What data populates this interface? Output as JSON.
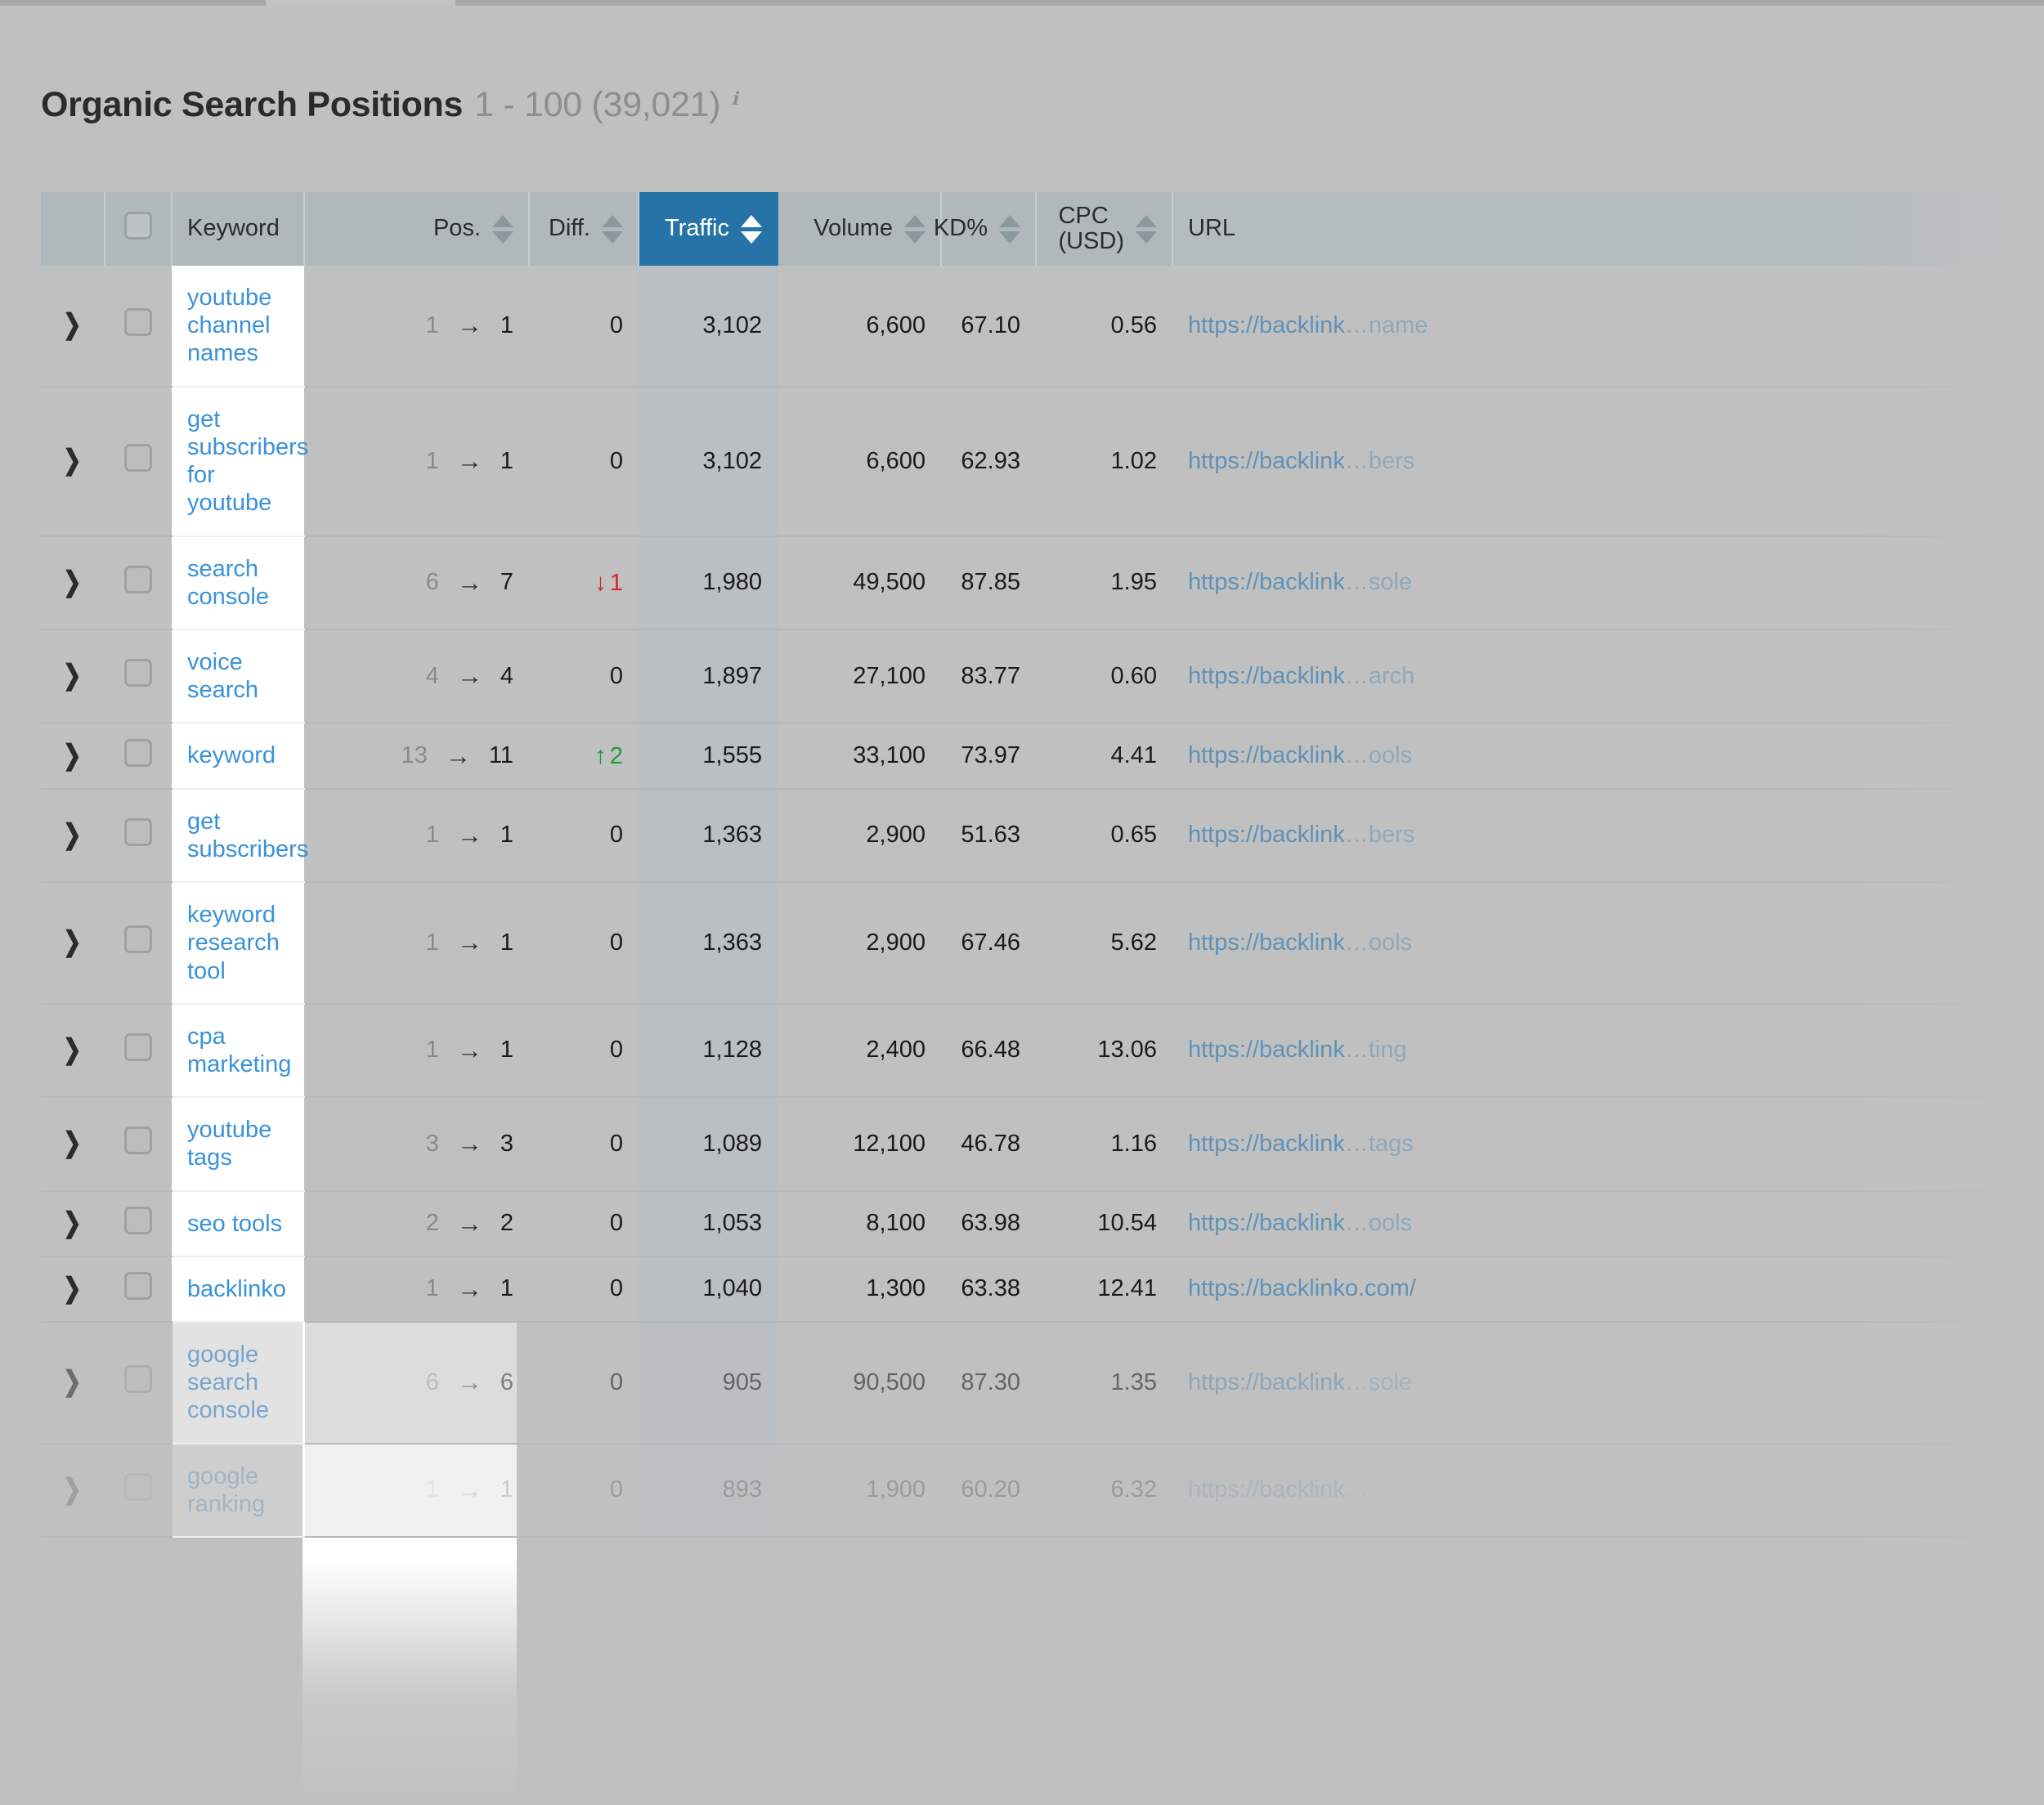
{
  "page": {
    "title_main": "Organic Search Positions",
    "title_range": "1 - 100 (39,021)",
    "info_icon": "info-icon"
  },
  "table": {
    "columns": [
      {
        "key": "expand",
        "label": "",
        "sortable": false,
        "align": "center"
      },
      {
        "key": "select",
        "label": "",
        "sortable": false,
        "align": "center"
      },
      {
        "key": "keyword",
        "label": "Keyword",
        "sortable": false,
        "align": "left"
      },
      {
        "key": "pos",
        "label": "Pos.",
        "sortable": true,
        "align": "right"
      },
      {
        "key": "diff",
        "label": "Diff.",
        "sortable": true,
        "align": "right"
      },
      {
        "key": "traffic",
        "label": "Traffic",
        "sortable": true,
        "align": "right",
        "active": true
      },
      {
        "key": "volume",
        "label": "Volume",
        "sortable": true,
        "align": "right"
      },
      {
        "key": "kd",
        "label": "KD%",
        "sortable": true,
        "align": "right"
      },
      {
        "key": "cpc",
        "label_line1": "CPC",
        "label_line2": "(USD)",
        "sortable": true,
        "align": "right"
      },
      {
        "key": "url",
        "label": "URL",
        "sortable": false,
        "align": "left"
      }
    ],
    "header_select_all": "select-all-checkbox",
    "sorted_by": "Traffic",
    "sort_direction": "desc",
    "rows": [
      {
        "keyword": "youtube channel names",
        "pos_old": "1",
        "pos_new": "1",
        "diff": "0",
        "diff_dir": "none",
        "traffic": "3,102",
        "volume": "6,600",
        "kd": "67.10",
        "cpc": "0.56",
        "url_head": "https://backlink",
        "url_tail": "…name",
        "fade": 0
      },
      {
        "keyword": "get subscribers for youtube",
        "pos_old": "1",
        "pos_new": "1",
        "diff": "0",
        "diff_dir": "none",
        "traffic": "3,102",
        "volume": "6,600",
        "kd": "62.93",
        "cpc": "1.02",
        "url_head": "https://backlink",
        "url_tail": "…bers",
        "fade": 0
      },
      {
        "keyword": "search console",
        "pos_old": "6",
        "pos_new": "7",
        "diff": "1",
        "diff_dir": "down",
        "traffic": "1,980",
        "volume": "49,500",
        "kd": "87.85",
        "cpc": "1.95",
        "url_head": "https://backlink",
        "url_tail": "…sole",
        "fade": 0
      },
      {
        "keyword": "voice search",
        "pos_old": "4",
        "pos_new": "4",
        "diff": "0",
        "diff_dir": "none",
        "traffic": "1,897",
        "volume": "27,100",
        "kd": "83.77",
        "cpc": "0.60",
        "url_head": "https://backlink",
        "url_tail": "…arch",
        "fade": 0
      },
      {
        "keyword": "keyword",
        "pos_old": "13",
        "pos_new": "11",
        "diff": "2",
        "diff_dir": "up",
        "traffic": "1,555",
        "volume": "33,100",
        "kd": "73.97",
        "cpc": "4.41",
        "url_head": "https://backlink",
        "url_tail": "…ools",
        "fade": 0
      },
      {
        "keyword": "get subscribers",
        "pos_old": "1",
        "pos_new": "1",
        "diff": "0",
        "diff_dir": "none",
        "traffic": "1,363",
        "volume": "2,900",
        "kd": "51.63",
        "cpc": "0.65",
        "url_head": "https://backlink",
        "url_tail": "…bers",
        "fade": 0
      },
      {
        "keyword": "keyword research tool",
        "pos_old": "1",
        "pos_new": "1",
        "diff": "0",
        "diff_dir": "none",
        "traffic": "1,363",
        "volume": "2,900",
        "kd": "67.46",
        "cpc": "5.62",
        "url_head": "https://backlink",
        "url_tail": "…ools",
        "fade": 0
      },
      {
        "keyword": "cpa marketing",
        "pos_old": "1",
        "pos_new": "1",
        "diff": "0",
        "diff_dir": "none",
        "traffic": "1,128",
        "volume": "2,400",
        "kd": "66.48",
        "cpc": "13.06",
        "url_head": "https://backlink",
        "url_tail": "…ting",
        "fade": 0
      },
      {
        "keyword": "youtube tags",
        "pos_old": "3",
        "pos_new": "3",
        "diff": "0",
        "diff_dir": "none",
        "traffic": "1,089",
        "volume": "12,100",
        "kd": "46.78",
        "cpc": "1.16",
        "url_head": "https://backlink",
        "url_tail": "…tags",
        "fade": 0
      },
      {
        "keyword": "seo tools",
        "pos_old": "2",
        "pos_new": "2",
        "diff": "0",
        "diff_dir": "none",
        "traffic": "1,053",
        "volume": "8,100",
        "kd": "63.98",
        "cpc": "10.54",
        "url_head": "https://backlink",
        "url_tail": "…ools",
        "fade": 0
      },
      {
        "keyword": "backlinko",
        "pos_old": "1",
        "pos_new": "1",
        "diff": "0",
        "diff_dir": "none",
        "traffic": "1,040",
        "volume": "1,300",
        "kd": "63.38",
        "cpc": "12.41",
        "url_head": "https://backlinko.com/",
        "url_tail": "",
        "fade": 0
      },
      {
        "keyword": "google search console",
        "pos_old": "6",
        "pos_new": "6",
        "diff": "0",
        "diff_dir": "none",
        "traffic": "905",
        "volume": "90,500",
        "kd": "87.30",
        "cpc": "1.35",
        "url_head": "https://backlink",
        "url_tail": "…sole",
        "fade": 1
      },
      {
        "keyword": "google ranking",
        "pos_old": "1",
        "pos_new": "1",
        "diff": "0",
        "diff_dir": "none",
        "traffic": "893",
        "volume": "1,900",
        "kd": "60.20",
        "cpc": "6.32",
        "url_head": "https://backlink",
        "url_tail": "…",
        "fade": 2
      }
    ]
  },
  "colors": {
    "accent_blue": "#2573a7",
    "link_blue": "#3a92d8",
    "url_blue": "#5f92b8",
    "diff_up_green": "#1f9a37",
    "diff_down_red": "#d3232b",
    "page_bg": "#c0c0c0",
    "header_bg": "#b0b8bc",
    "traffic_col_bg": "#b9bfc3"
  }
}
